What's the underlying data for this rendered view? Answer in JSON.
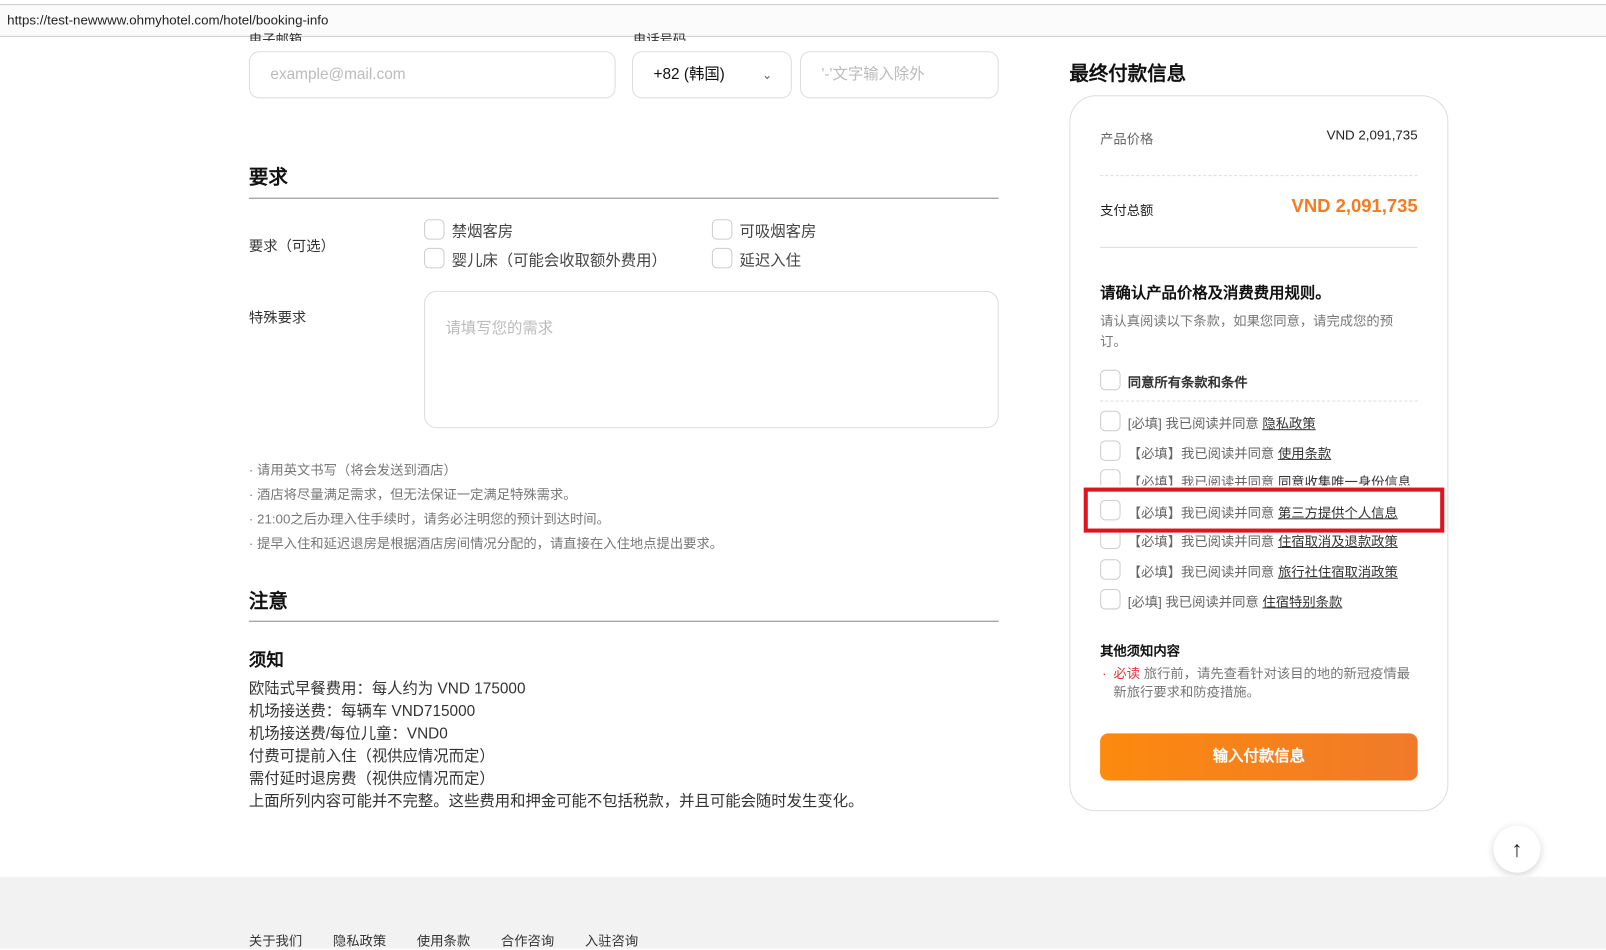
{
  "browser": {
    "url": "https://test-newwww.ohmyhotel.com/hotel/booking-info"
  },
  "contact": {
    "email_label": "电子邮箱",
    "phone_label": "电话号码",
    "email_placeholder": "example@mail.com",
    "country_code": "+82 (韩国)",
    "phone_placeholder": "'-'文字输入除外"
  },
  "requests": {
    "title": "要求",
    "optional_label": "要求（可选）",
    "options": [
      "禁烟客房",
      "可吸烟客房",
      "婴儿床（可能会收取额外费用）",
      "延迟入住"
    ],
    "special_label": "特殊要求",
    "special_placeholder": "请填写您的需求",
    "notes": [
      "· 请用英文书写（将会发送到酒店）",
      "· 酒店将尽量满足需求，但无法保证一定满足特殊需求。",
      "· 21:00之后办理入住手续时，请务必注明您的预计到达时间。",
      "· 提早入住和延迟退房是根据酒店房间情况分配的，请直接在入住地点提出要求。"
    ]
  },
  "notice": {
    "title": "注意",
    "subtitle": "须知",
    "lines": [
      "欧陆式早餐费用：每人约为 VND 175000",
      "机场接送费：每辆车 VND715000",
      "机场接送费/每位儿童：VND0",
      "付费可提前入住（视供应情况而定）",
      "需付延时退房费（视供应情况而定）",
      "上面所列内容可能并不完整。这些费用和押金可能不包括税款，并且可能会随时发生变化。"
    ]
  },
  "payment": {
    "title": "最终付款信息",
    "product_price_label": "产品价格",
    "product_price": "VND 2,091,735",
    "total_label": "支付总额",
    "total": "VND 2,091,735",
    "confirm_title": "请确认产品价格及消费费用规则。",
    "confirm_desc": "请认真阅读以下条款，如果您同意，请完成您的预订。",
    "agree_all": "同意所有条款和条件",
    "terms": [
      {
        "prefix": "[必填] 我已阅读并同意 ",
        "link": "隐私政策"
      },
      {
        "prefix": "【必填】我已阅读并同意 ",
        "link": "使用条款"
      },
      {
        "prefix": "【必填】我已阅读并同意 ",
        "link": "同意收集唯一身份信息"
      },
      {
        "prefix": "【必填】我已阅读并同意 ",
        "link": "第三方提供个人信息"
      },
      {
        "prefix": "【必填】我已阅读并同意 ",
        "link": "住宿取消及退款政策"
      },
      {
        "prefix": "【必填】我已阅读并同意 ",
        "link": "旅行社住宿取消政策"
      },
      {
        "prefix": "[必填] 我已阅读并同意 ",
        "link": "住宿特别条款"
      }
    ],
    "other_title": "其他须知内容",
    "must_read": "必读",
    "other_text": "旅行前，请先查看针对该目的地的新冠疫情最新旅行要求和防疫措施。",
    "submit": "输入付款信息",
    "accent": "#f47b20"
  },
  "footer": {
    "links": [
      "关于我们",
      "隐私政策",
      "使用条款",
      "合作咨询",
      "入驻咨询"
    ]
  }
}
